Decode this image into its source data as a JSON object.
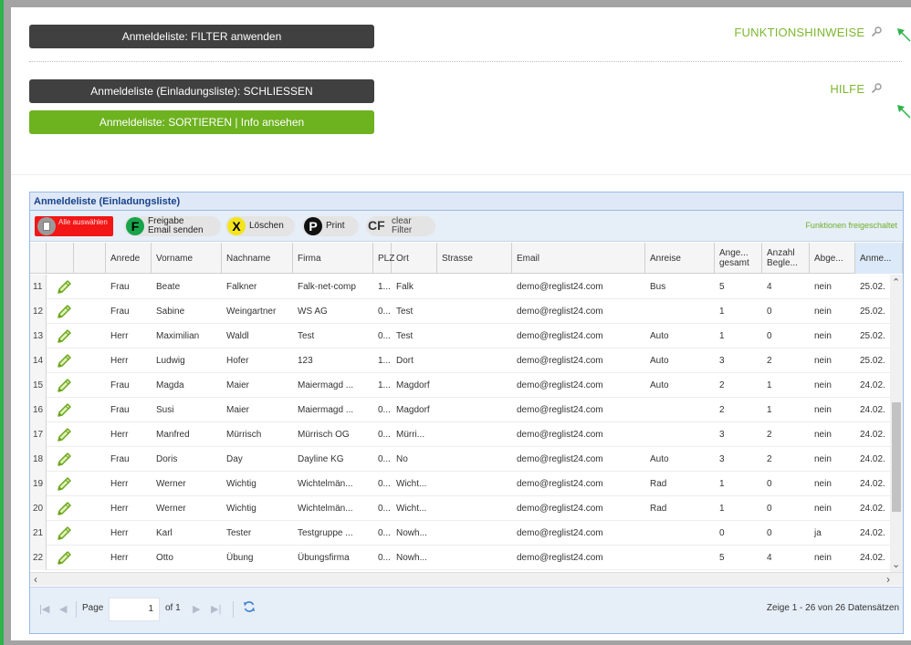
{
  "buttons": {
    "filter": "Anmeldeliste: FILTER anwenden",
    "close": "Anmeldeliste (Einladungsliste): SCHLIESSEN",
    "sort": "Anmeldeliste: SORTIEREN | Info ansehen"
  },
  "links": {
    "hints": "FUNKTIONSHINWEISE",
    "help": "HILFE"
  },
  "panel": {
    "title": "Anmeldeliste (Einladungsliste)"
  },
  "toolbar": {
    "select_all": "Alle auswählen",
    "release_line1": "Freigabe",
    "release_line2": "Email senden",
    "delete": "Löschen",
    "print": "Print",
    "clear_line1": "clear",
    "clear_line2": "Filter",
    "functions_enabled": "Funktionen freigeschaltet"
  },
  "columns": [
    {
      "key": "anrede",
      "label": "Anrede"
    },
    {
      "key": "vorname",
      "label": "Vorname"
    },
    {
      "key": "nachname",
      "label": "Nachname"
    },
    {
      "key": "firma",
      "label": "Firma"
    },
    {
      "key": "plz",
      "label": "PLZ"
    },
    {
      "key": "ort",
      "label": "Ort"
    },
    {
      "key": "strasse",
      "label": "Strasse"
    },
    {
      "key": "email",
      "label": "Email"
    },
    {
      "key": "anreise",
      "label": "Anreise"
    },
    {
      "key": "ange",
      "label1": "Ange...",
      "label2": "gesamt"
    },
    {
      "key": "begl",
      "label1": "Anzahl",
      "label2": "Begle..."
    },
    {
      "key": "abge",
      "label": "Abge..."
    },
    {
      "key": "anme",
      "label": "Anme..."
    }
  ],
  "rows": [
    {
      "n": "11",
      "anrede": "Frau",
      "vorname": "Beate",
      "nachname": "Falkner",
      "firma": "Falk-net-comp",
      "plz": "1...",
      "ort": "Falk",
      "strasse": "",
      "email": "demo@reglist24.com",
      "anreise": "Bus",
      "ange": "5",
      "begl": "4",
      "abge": "nein",
      "anme": "25.02."
    },
    {
      "n": "12",
      "anrede": "Frau",
      "vorname": "Sabine",
      "nachname": "Weingartner",
      "firma": "WS AG",
      "plz": "0...",
      "ort": "Test",
      "strasse": "",
      "email": "demo@reglist24.com",
      "anreise": "",
      "ange": "1",
      "begl": "0",
      "abge": "nein",
      "anme": "25.02."
    },
    {
      "n": "13",
      "anrede": "Herr",
      "vorname": "Maximilian",
      "nachname": "Waldl",
      "firma": "Test",
      "plz": "0...",
      "ort": "Test",
      "strasse": "",
      "email": "demo@reglist24.com",
      "anreise": "Auto",
      "ange": "1",
      "begl": "0",
      "abge": "nein",
      "anme": "25.02."
    },
    {
      "n": "14",
      "anrede": "Herr",
      "vorname": "Ludwig",
      "nachname": "Hofer",
      "firma": "123",
      "plz": "1...",
      "ort": "Dort",
      "strasse": "",
      "email": "demo@reglist24.com",
      "anreise": "Auto",
      "ange": "3",
      "begl": "2",
      "abge": "nein",
      "anme": "25.02."
    },
    {
      "n": "15",
      "anrede": "Frau",
      "vorname": "Magda",
      "nachname": "Maier",
      "firma": "Maiermagd ...",
      "plz": "1...",
      "ort": "Magdorf",
      "strasse": "",
      "email": "demo@reglist24.com",
      "anreise": "Auto",
      "ange": "2",
      "begl": "1",
      "abge": "nein",
      "anme": "24.02."
    },
    {
      "n": "16",
      "anrede": "Frau",
      "vorname": "Susi",
      "nachname": "Maier",
      "firma": "Maiermagd ...",
      "plz": "0...",
      "ort": "Magdorf",
      "strasse": "",
      "email": "demo@reglist24.com",
      "anreise": "",
      "ange": "2",
      "begl": "1",
      "abge": "nein",
      "anme": "24.02."
    },
    {
      "n": "17",
      "anrede": "Herr",
      "vorname": "Manfred",
      "nachname": "Mürrisch",
      "firma": "Mürrisch OG",
      "plz": "0...",
      "ort": "Mürri...",
      "strasse": "",
      "email": "demo@reglist24.com",
      "anreise": "",
      "ange": "3",
      "begl": "2",
      "abge": "nein",
      "anme": "24.02."
    },
    {
      "n": "18",
      "anrede": "Frau",
      "vorname": "Doris",
      "nachname": "Day",
      "firma": "Dayline KG",
      "plz": "0...",
      "ort": "No",
      "strasse": "",
      "email": "demo@reglist24.com",
      "anreise": "Auto",
      "ange": "3",
      "begl": "2",
      "abge": "nein",
      "anme": "24.02."
    },
    {
      "n": "19",
      "anrede": "Herr",
      "vorname": "Werner",
      "nachname": "Wichtig",
      "firma": "Wichtelmän...",
      "plz": "0...",
      "ort": "Wicht...",
      "strasse": "",
      "email": "demo@reglist24.com",
      "anreise": "Rad",
      "ange": "1",
      "begl": "0",
      "abge": "nein",
      "anme": "24.02."
    },
    {
      "n": "20",
      "anrede": "Herr",
      "vorname": "Werner",
      "nachname": "Wichtig",
      "firma": "Wichtelmän...",
      "plz": "0...",
      "ort": "Wicht...",
      "strasse": "",
      "email": "demo@reglist24.com",
      "anreise": "Rad",
      "ange": "1",
      "begl": "0",
      "abge": "nein",
      "anme": "24.02."
    },
    {
      "n": "21",
      "anrede": "Herr",
      "vorname": "Karl",
      "nachname": "Tester",
      "firma": "Testgruppe ...",
      "plz": "0...",
      "ort": "Nowh...",
      "strasse": "",
      "email": "demo@reglist24.com",
      "anreise": "",
      "ange": "0",
      "begl": "0",
      "abge": "ja",
      "anme": "24.02."
    },
    {
      "n": "22",
      "anrede": "Herr",
      "vorname": "Otto",
      "nachname": "Übung",
      "firma": "Übungsfirma",
      "plz": "0...",
      "ort": "Nowh...",
      "strasse": "",
      "email": "demo@reglist24.com",
      "anreise": "",
      "ange": "5",
      "begl": "4",
      "abge": "nein",
      "anme": "24.02."
    }
  ],
  "paging": {
    "page_label": "Page",
    "page_value": "1",
    "of_label": "of 1",
    "info": "Zeige 1 - 26 von 26 Datensätzen"
  },
  "icons": {
    "pencil": "pencil-icon",
    "search": "magnifier-icon",
    "refresh": "refresh-icon"
  },
  "colors": {
    "accent_green": "#6db21f",
    "link_green": "#7cb82f",
    "dark_button": "#404040",
    "select_red": "#f21616",
    "panel_border": "#99bbe8",
    "panel_header": "#dfe8f6"
  }
}
